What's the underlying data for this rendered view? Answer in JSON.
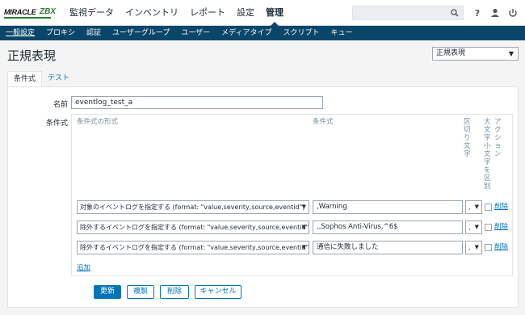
{
  "brand": {
    "logo_text": "MIRACLE",
    "logo_suffix": "ZBX"
  },
  "main_menu": [
    "監視データ",
    "インベントリ",
    "レポート",
    "設定",
    "管理"
  ],
  "main_menu_active": "管理",
  "top_icons": [
    "search-icon",
    "help-icon",
    "user-icon",
    "power-icon"
  ],
  "sub_menu": [
    "一般設定",
    "プロキシ",
    "認証",
    "ユーザーグループ",
    "ユーザー",
    "メディアタイプ",
    "スクリプト",
    "キュー"
  ],
  "page_title": "正規表現",
  "header_select": "正規表現",
  "tabs": {
    "conditions": "条件式",
    "test": "テスト"
  },
  "form": {
    "name_label": "名前",
    "name_value": "eventlog_test_a",
    "expressions_label": "条件式"
  },
  "table_headers": {
    "type": "条件式の形式",
    "expression": "条件式",
    "delimiter": "区切り文字",
    "case_sensitive": "大文字小文字を区別",
    "action": "アクション"
  },
  "expressions": [
    {
      "type": "対象のイベントログを指定する (format: \"value,severity,source,eventid\")",
      "expression": ",Warning",
      "delimiter": ",",
      "case_sensitive": false,
      "remove": "削除"
    },
    {
      "type": "除外するイベントログを指定する (format: \"value,severity,source,eventid\")",
      "expression": ",,Sophos Anti-Virus,^6$",
      "delimiter": ",",
      "case_sensitive": false,
      "remove": "削除"
    },
    {
      "type": "除外するイベントログを指定する (format: \"value,severity,source,eventid\")",
      "expression": "通信に失敗しました",
      "delimiter": ",",
      "case_sensitive": false,
      "remove": "削除"
    }
  ],
  "add_link": "追加",
  "buttons": {
    "update": "更新",
    "clone": "複製",
    "delete": "削除",
    "cancel": "キャンセル"
  },
  "colors": {
    "nav": "#0a466a",
    "accent": "#0275b8",
    "logo_green": "#2e7d32"
  }
}
